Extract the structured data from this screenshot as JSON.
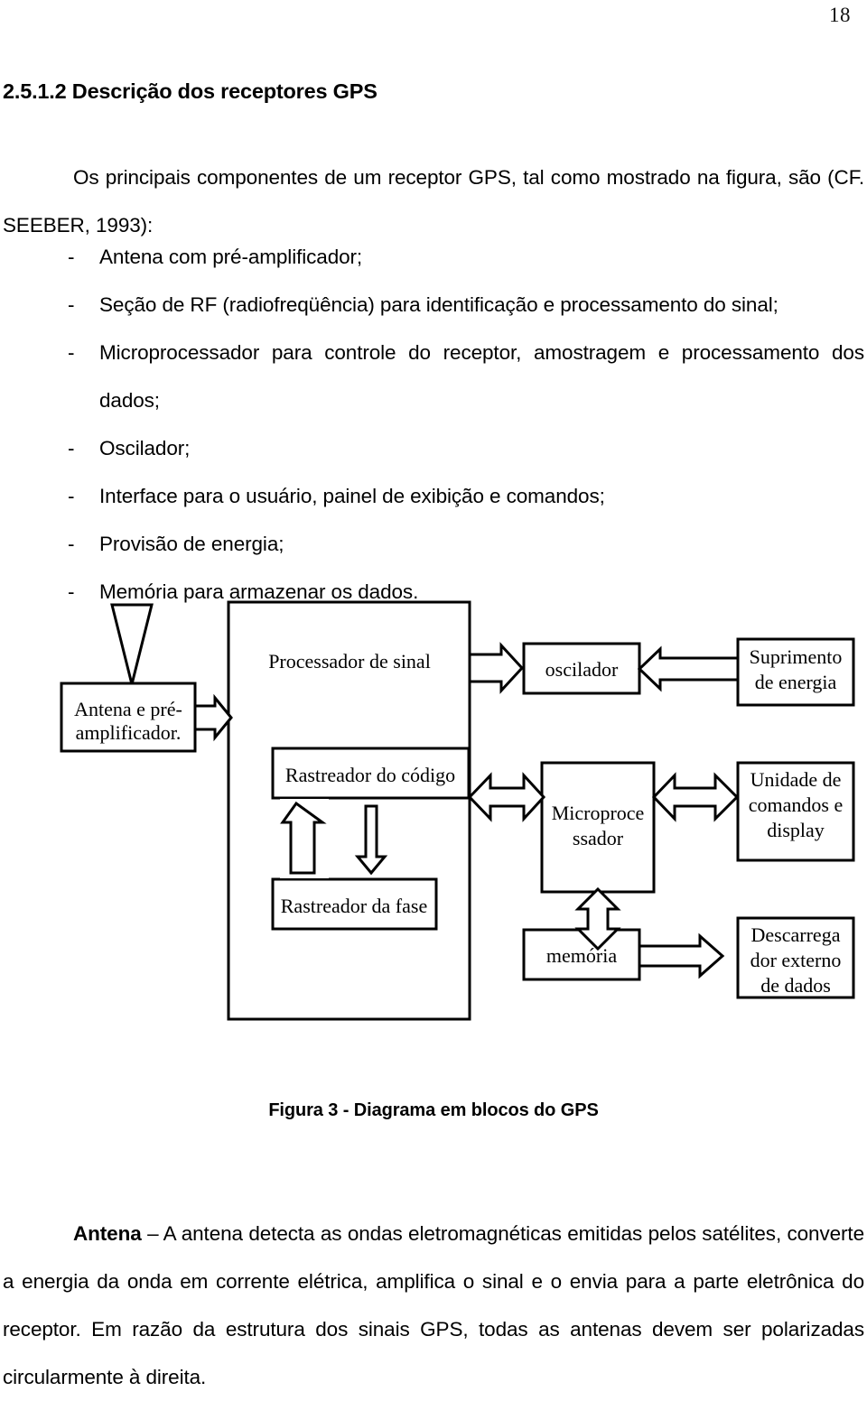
{
  "page": {
    "number": "18"
  },
  "heading": {
    "text": "2.5.1.2 Descrição dos receptores GPS"
  },
  "intro": {
    "text": "Os principais componentes de um receptor GPS, tal como mostrado na figura, são (CF. SEEBER, 1993):"
  },
  "bullets": {
    "dash": "-",
    "items": [
      {
        "text": "Antena com pré-amplificador;"
      },
      {
        "text": "Seção de RF (radiofreqüência) para identificação e processamento do sinal;"
      },
      {
        "text": "Microprocessador para controle do receptor, amostragem e processamento dos dados;"
      },
      {
        "text": "Oscilador;"
      },
      {
        "text": "Interface para o usuário, painel de exibição e comandos;"
      },
      {
        "text": "Provisão de energia;"
      },
      {
        "text": "Memória para armazenar os dados."
      }
    ]
  },
  "figure": {
    "caption": "Figura 3 -  Diagrama em blocos do GPS",
    "blocks": {
      "antenna": "Antena e pré-amplificador.",
      "signal_processor": "Processador de sinal",
      "code_tracker": "Rastreador do código",
      "phase_tracker": "Rastreador da fase",
      "oscillator": "oscilador",
      "power_supply_line1": "Suprimento",
      "power_supply_line2": "de energia",
      "microprocessor_line1": "Microproce",
      "microprocessor_line2": "ssador",
      "command_unit_line1": "Unidade de",
      "command_unit_line2": "comandos e",
      "command_unit_line3": "display",
      "memory": "memória",
      "external_downloader_line1": "Descarrega",
      "external_downloader_line2": "dor externo",
      "external_downloader_line3": "de dados"
    }
  },
  "closing": {
    "lead": "Antena",
    "text": " – A antena detecta as ondas eletromagnéticas emitidas pelos satélites, converte a energia da onda em corrente elétrica, amplifica o sinal e o envia para a parte eletrônica do receptor. Em razão da estrutura dos sinais GPS, todas as antenas devem ser polarizadas circularmente à direita."
  },
  "colors": {
    "ink": "#000000",
    "paper": "#ffffff"
  }
}
